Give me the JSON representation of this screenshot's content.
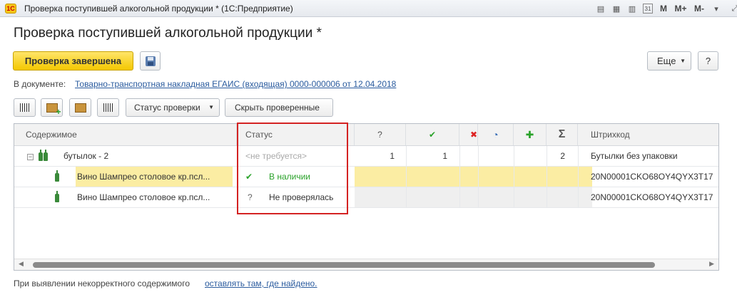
{
  "window": {
    "app_logo": "1С",
    "title": "Проверка поступившей алкогольной продукции * (1С:Предприятие)",
    "calendar_day": "31",
    "m_label": "M",
    "m_plus_label": "M+",
    "m_minus_label": "M-"
  },
  "form": {
    "title": "Проверка поступившей алкогольной продукции *",
    "primary_button": "Проверка завершена",
    "more_button": "Еще",
    "help_button": "?",
    "doc_label": "В документе:",
    "doc_link": "Товарно-транспортная накладная ЕГАИС (входящая) 0000-000006 от 12.04.2018"
  },
  "toolbar": {
    "status_dropdown": "Статус проверки",
    "hide_checked": "Скрыть проверенные"
  },
  "table": {
    "headers": {
      "content": "Содержимое",
      "status": "Статус",
      "q": "?",
      "check": "✔",
      "cross": "✖",
      "pie": "◔",
      "plus": "✚",
      "sum": "Σ",
      "barcode": "Штрихкод"
    },
    "rows": [
      {
        "content": "бутылок - 2",
        "status": "<не требуется>",
        "q": "1",
        "check": "1",
        "sum": "2",
        "barcode": "Бутылки без упаковки"
      },
      {
        "content": "Вино Шампрео столовое кр.псл...",
        "status_icon": "✔",
        "status": "В наличии",
        "barcode": "20N00001CKO68OY4QYX3T17"
      },
      {
        "content": "Вино Шампрео столовое кр.псл...",
        "status_icon": "?",
        "status": "Не проверялась",
        "barcode": "20N00001CKO68OY4QYX3T17"
      }
    ]
  },
  "footer": {
    "text": "При выявлении некорректного содержимого",
    "link": "оставлять там, где найдено."
  },
  "colors": {
    "primary_button": "#f4c800",
    "selected_row": "#fbeda3",
    "highlight_box": "#d42222",
    "link": "#2a5b9e",
    "ok_green": "#2aa22a"
  }
}
